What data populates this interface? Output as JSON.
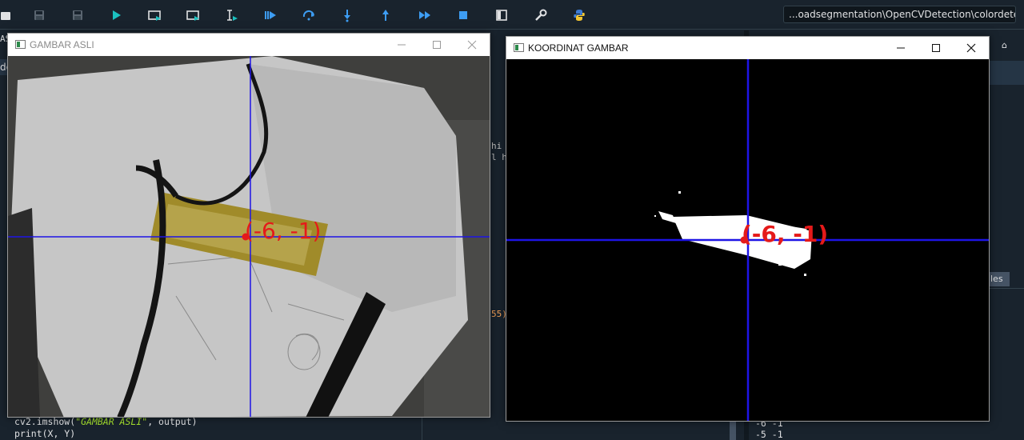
{
  "ide": {
    "path": "...oadsegmentation\\OpenCVDetection\\colordetection",
    "toolbar_icons": [
      "new-file-icon",
      "save-icon",
      "save-all-icon",
      "run-icon",
      "run-cell-icon",
      "run-cell-advance-icon",
      "run-selection-icon",
      "debug-icon",
      "step-over-icon",
      "step-into-icon",
      "step-out-icon",
      "continue-icon",
      "stop-icon",
      "maximize-pane-icon",
      "preferences-icon",
      "python-path-icon"
    ],
    "tab_peek": "de",
    "left_edge_frag": "AS",
    "code_frag_1": "hi",
    "code_frag_2": "l h",
    "code_frag_3": "55)",
    "code_lines": [
      {
        "prefix": "cv2.imshow(",
        "string": "\"GAMBAR ASLI\"",
        "suffix": ", output)"
      },
      {
        "prefix": "print(X, Y)",
        "string": "",
        "suffix": ""
      }
    ],
    "right_tab_label": "les",
    "console_lines": [
      "-6 -1",
      "-5 -1"
    ]
  },
  "window_asli": {
    "title": "GAMBAR ASLI",
    "coord_label": "(-6, -1)"
  },
  "window_koordinat": {
    "title": "KOORDINAT GAMBAR",
    "coord_label": "(-6, -1)"
  },
  "colors": {
    "crosshair": "#1e14e6",
    "coord_text": "#e51a1a",
    "ide_bg": "#19232d",
    "run_accent": "#3d9df3"
  }
}
